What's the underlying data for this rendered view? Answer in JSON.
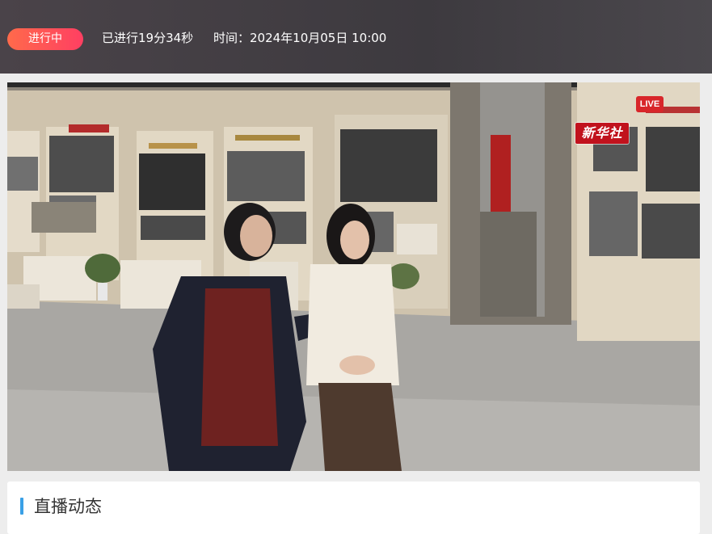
{
  "header": {
    "status": "进行中",
    "elapsed": "已进行19分34秒",
    "time": "时间：2024年10月05日 10:00"
  },
  "video": {
    "live_label": "LIVE",
    "logo_text": "新华社"
  },
  "section": {
    "title": "直播动态"
  },
  "colors": {
    "status_gradient_start": "#ff6a4b",
    "status_gradient_end": "#ff3f62",
    "live_red": "#d8262a",
    "section_accent": "#3aa0e6"
  }
}
